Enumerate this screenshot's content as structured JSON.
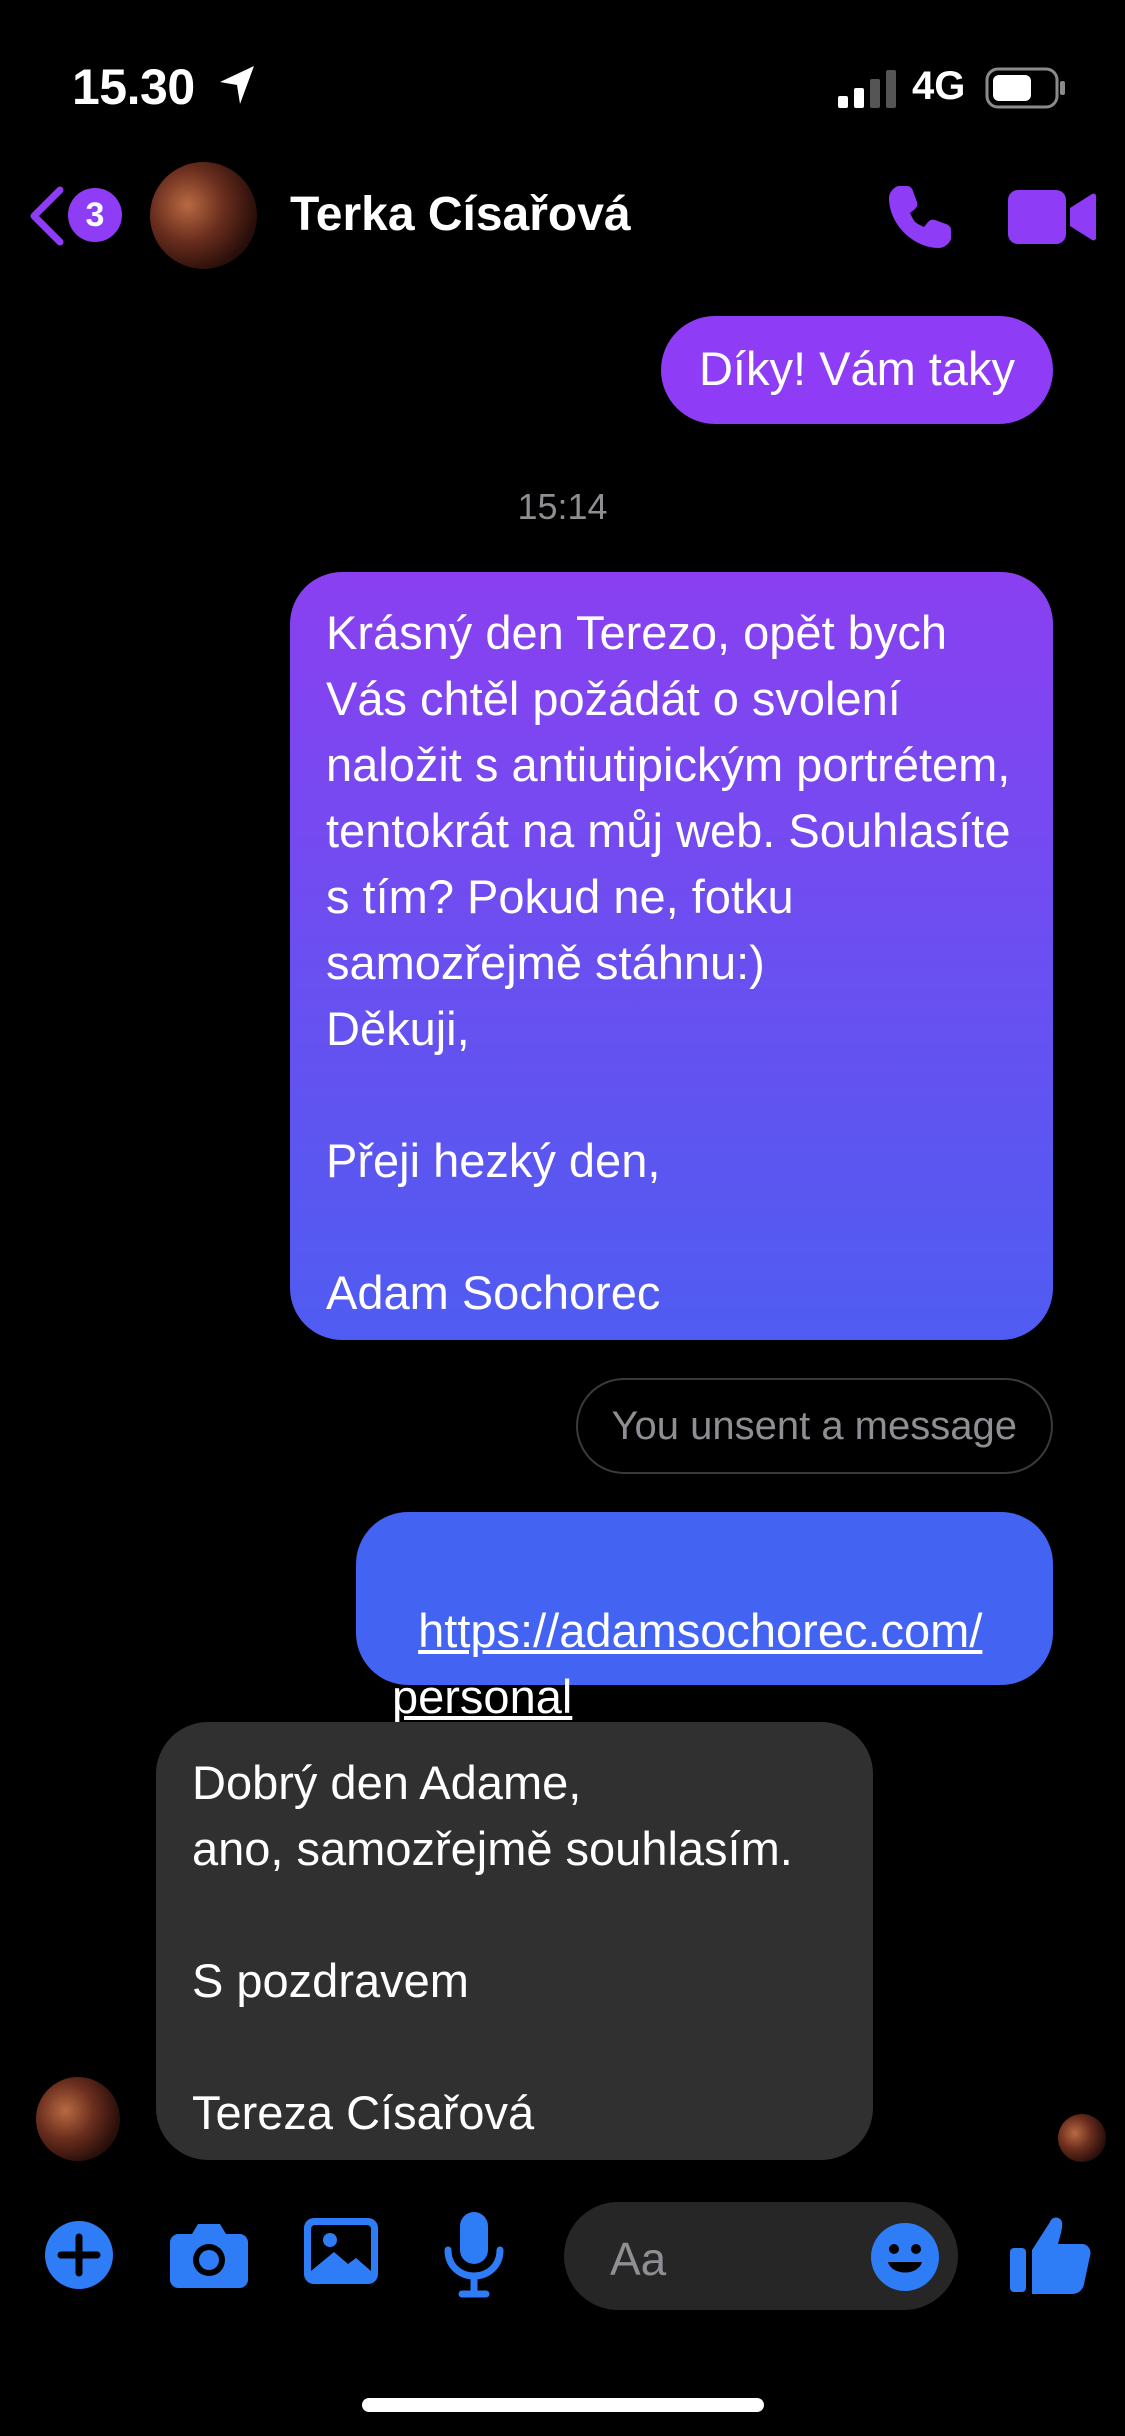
{
  "status_bar": {
    "time": "15.30",
    "network": "4G",
    "icons": [
      "location-arrow-icon",
      "cellular-signal-icon",
      "battery-icon"
    ]
  },
  "header": {
    "unread_count": "3",
    "contact_name": "Terka Císařová",
    "icons": [
      "back-chevron-icon",
      "phone-icon",
      "video-camera-icon"
    ]
  },
  "messages": [
    {
      "direction": "outgoing",
      "text": "Díky! Vám taky"
    },
    {
      "type": "timestamp",
      "text": "15:14"
    },
    {
      "direction": "outgoing",
      "text": "Krásný den Terezo, opět bych Vás chtěl požádát o svolení naložit s antiutipickým portrétem, tentokrát na můj web. Souhlasíte s tím? Pokud ne, fotku samozřejmě stáhnu:)\nDěkuji,\n\nPřeji hezký den,\n\nAdam Sochorec"
    },
    {
      "type": "notice",
      "text": "You unsent a message"
    },
    {
      "direction": "outgoing",
      "link": "https://adamsochorec.com/personal",
      "link_line1": "https://adamsochorec.com/",
      "link_line2": "personal"
    },
    {
      "direction": "incoming",
      "text": "Dobrý den Adame,\nano, samozřejmě souhlasím.\n\nS pozdravem\n\nTereza Císařová"
    }
  ],
  "composer": {
    "placeholder": "Aa",
    "icons": [
      "plus-icon",
      "camera-icon",
      "image-icon",
      "microphone-icon",
      "emoji-icon",
      "thumbs-up-icon"
    ]
  },
  "colors": {
    "accent_purple": "#8e3cf5",
    "accent_blue": "#4363f3",
    "incoming_bubble": "#303030",
    "composer_blue": "#2e7cf6"
  }
}
